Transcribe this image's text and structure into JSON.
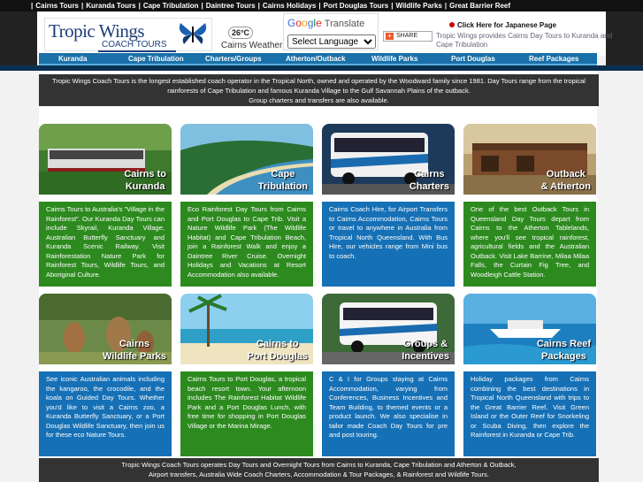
{
  "top_links": [
    "Cairns Tours",
    "Kuranda Tours",
    "Cape Tribulation",
    "Daintree Tours",
    "Cairns Holidays",
    "Port Douglas Tours",
    "Wildlife Parks",
    "Great Barrier Reef"
  ],
  "logo": {
    "name": "Tropic Wings",
    "sub": "COACH TOURS"
  },
  "weather": {
    "temp": "26°C",
    "label": "Cairns Weather"
  },
  "translate": {
    "brand_letters": [
      "G",
      "o",
      "o",
      "g",
      "l",
      "e"
    ],
    "label": "Translate",
    "select_value": "Select Language"
  },
  "share_label": "SHARE",
  "japanese_link": "Click Here for Japanese Page",
  "japanese_sub": "Tropic Wings provides Cairns Day Tours to Kuranda and Cape Tribulation",
  "nav": [
    "Kuranda",
    "Cape Tribulation",
    "Charters/Groups",
    "Atherton/Outback",
    "Wildlife Parks",
    "Port Douglas",
    "Reef Packages"
  ],
  "intro": {
    "line1": "Tropic Wings Coach Tours is the longest established coach operator in the Tropical North, owned and operated by the Woodward family since 1981. Day Tours range from the tropical",
    "line2": "rainforests of Cape Tribulation and famous Kuranda Village to the Gulf Savannah Plains of the outback.",
    "line3": "Group charters and transfers are also available."
  },
  "cards": [
    {
      "title1": "Cairns to",
      "title2": "Kuranda",
      "desc": "Cairns Tours to Australia's \"Village in the Rainforest\". Our Kuranda Day Tours can include Skyrail, Kuranda Village, Australian Butterfly Sanctuary and Kuranda Scenic Railway. Visit Rainforestation Nature Park for Rainforest Tours, Wildlife Tours, and Aboriginal Culture."
    },
    {
      "title1": "Cape",
      "title2": "Tribulation",
      "desc": "Eco Rainforest Day Tours from Cairns and Port Douglas to Cape Trib. Visit a Nature Wildlife Park (The Wildlife Habitat) and Cape Tribulation Beach, join a Rainforest Walk and enjoy a Daintree River Cruise. Overnight Holidays and Vacations at Resort Accommodation also available."
    },
    {
      "title1": "Cairns",
      "title2": "Charters",
      "desc": "Cairns Coach Hire, for Airport Transfers to Cairns Accommodation, Cairns Tours or travel to anywhere in Australia from Tropical North Queensland. With Bus Hire, our vehicles range from Mini bus to coach."
    },
    {
      "title1": "Outback",
      "title2": "& Atherton",
      "desc": "One of the best Outback Tours in Queensland Day Tours depart from Cairns to the Atherton Tablelands, where you'll see tropical rainforest, agricultural fields and the Australian Outback. Visit Lake Barrine, Milaa Milaa Falls, the Curtain Fig Tree, and Woodleigh Cattle Station."
    },
    {
      "title1": "Cairns",
      "title2": "Wildlife Parks",
      "desc": "See iconic Australian animals including the kangaroo, the crocodile, and the koala on Guided Day Tours. Whether you'd like to visit a Cairns zoo, a Kuranda Butterfly Sanctuary, or a Port Douglas Wildlife Sanctuary, then join us for these eco Nature Tours."
    },
    {
      "title1": "Cairns to",
      "title2": "Port Douglas",
      "desc": "Cairns Tours to Port Douglas, a tropical beach resort town. Your afternoon includes The Rainforest Habitat Wildlife Park and a Port Douglas Lunch, with free time for shopping in Port Douglas Village or the Marina Mirage."
    },
    {
      "title1": "Groups &",
      "title2": "Incentives",
      "desc": "C & I for Groups staying at Cairns Accommodation, varying from Conferences, Business Incentives and Team Building, to themed events or a product launch. We also specialise in tailor made Coach Day Tours for pre and post touring."
    },
    {
      "title1": "Cairns Reef",
      "title2": "Packages",
      "desc": "Holiday packages from Cairns combining the best destinations in Tropical North Queensland with trips to the Great Barrier Reef. Visit Green Island or the Outer Reef for Snorkeling or Scuba Diving, then explore the Rainforest in Kuranda or Cape Trib."
    }
  ],
  "footer": {
    "line1": "Tropic Wings Coach Tours operates Day Tours and Overnight Tours from Cairns to Kuranda, Cape Tribulation and Atherton & Outback,",
    "line2": "Airport transfers, Australia Wide Coach Charters, Accommodation & Tour Packages, & Rainforest and Wildlife Tours."
  }
}
